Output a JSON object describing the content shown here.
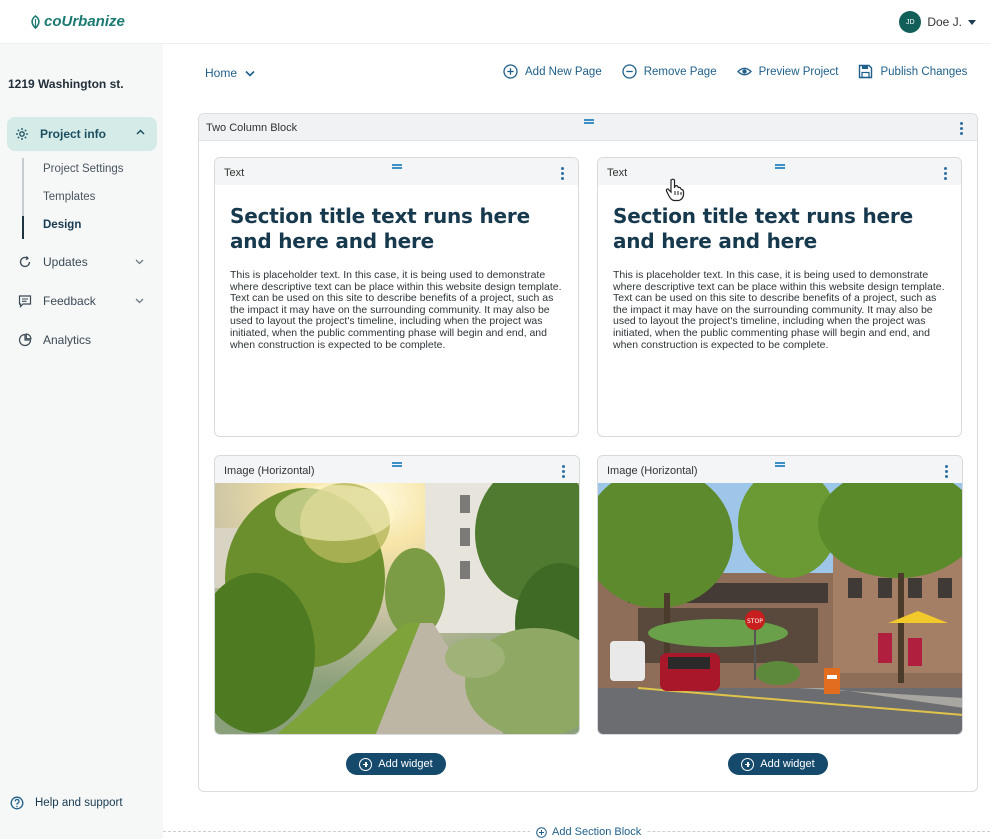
{
  "header": {
    "logo": "coUrbanize",
    "user_initials": "JD",
    "user_name": "Doe J."
  },
  "sidebar": {
    "project_name": "1219 Washington st.",
    "project_info": "Project info",
    "subitems": [
      "Project Settings",
      "Templates",
      "Design"
    ],
    "updates": "Updates",
    "feedback": "Feedback",
    "analytics": "Analytics",
    "help": "Help and support"
  },
  "toolbar": {
    "home": "Home",
    "add_page": "Add New Page",
    "remove_page": "Remove Page",
    "preview": "Preview Project",
    "publish": "Publish Changes"
  },
  "block": {
    "title": "Two  Column Block",
    "text_left": {
      "label": "Text",
      "heading": "Section title text runs here and here and here",
      "body": "This is placeholder text. In this case, it is being used to demonstrate where descriptive text can be place within this website design template. Text can be used on this site to describe benefits of a project, such as the impact it may have on the surrounding community. It may also be used to layout the project's timeline, including when the project was initiated, when the public commenting phase will begin and end, and when construction is expected to be complete."
    },
    "text_right": {
      "label": "Text",
      "heading": "Section title text runs here and here and here",
      "body": "This is placeholder text. In this case, it is being used to demonstrate where descriptive text can be place within this website design template. Text can be used on this site to describe benefits of a project, such as the impact it may have on the surrounding community. It may also be used to layout the project's timeline, including when the project was initiated, when the public commenting phase will begin and end, and when construction is expected to be complete."
    },
    "image_left": {
      "label": "Image (Horizontal)"
    },
    "image_right": {
      "label": "Image (Horizontal)"
    },
    "stop_sign": "STOP",
    "add_widget": "Add widget"
  },
  "add_section": "Add Section Block",
  "colors": {
    "brand": "#1b7a72",
    "primary": "#164a6c",
    "link": "#1f5f8a",
    "active_bg": "#d5ebe8"
  }
}
